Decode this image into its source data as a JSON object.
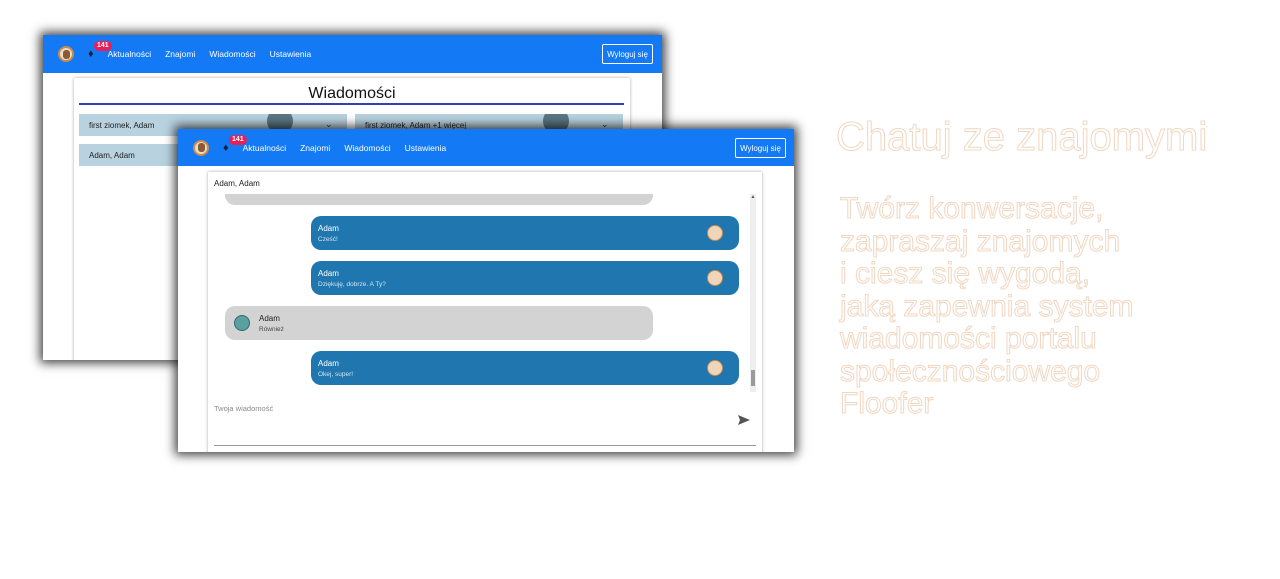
{
  "nav": {
    "badge_count": "141",
    "links": [
      "Aktualności",
      "Znajomi",
      "Wiadomości",
      "Ustawienia"
    ],
    "logout_label": "Wyloguj się"
  },
  "back_window": {
    "page_title": "Wiadomości",
    "conversations": [
      {
        "label": "first ziomek, Adam"
      },
      {
        "label": "first ziomek, Adam +1 więcej"
      },
      {
        "label": "Adam, Adam"
      }
    ]
  },
  "chat": {
    "title": "Adam, Adam",
    "messages": [
      {
        "author": "Adam",
        "text": "Cześć!",
        "mine": true
      },
      {
        "author": "Adam",
        "text": "Dziękuję, dobrze. A Ty?",
        "mine": true
      },
      {
        "author": "Adam",
        "text": "Również",
        "mine": false
      },
      {
        "author": "Adam",
        "text": "Okej, super!",
        "mine": true
      }
    ],
    "input_placeholder": "Twoja wiadomość"
  },
  "promo": {
    "heading": "Chatuj ze znajomymi",
    "lines": [
      "Twórz konwersacje,",
      "zapraszaj znajomych",
      "i ciesz się wygodą,",
      "jaką zapewnia system",
      "wiadomości portalu",
      "społecznościowego",
      "Floofer"
    ]
  },
  "colors": {
    "navbar": "#1479f5",
    "my_message": "#2077b0",
    "other_message": "#d3d3d3",
    "badge": "#e8205a",
    "promo_outline": "#f0d7c2"
  }
}
